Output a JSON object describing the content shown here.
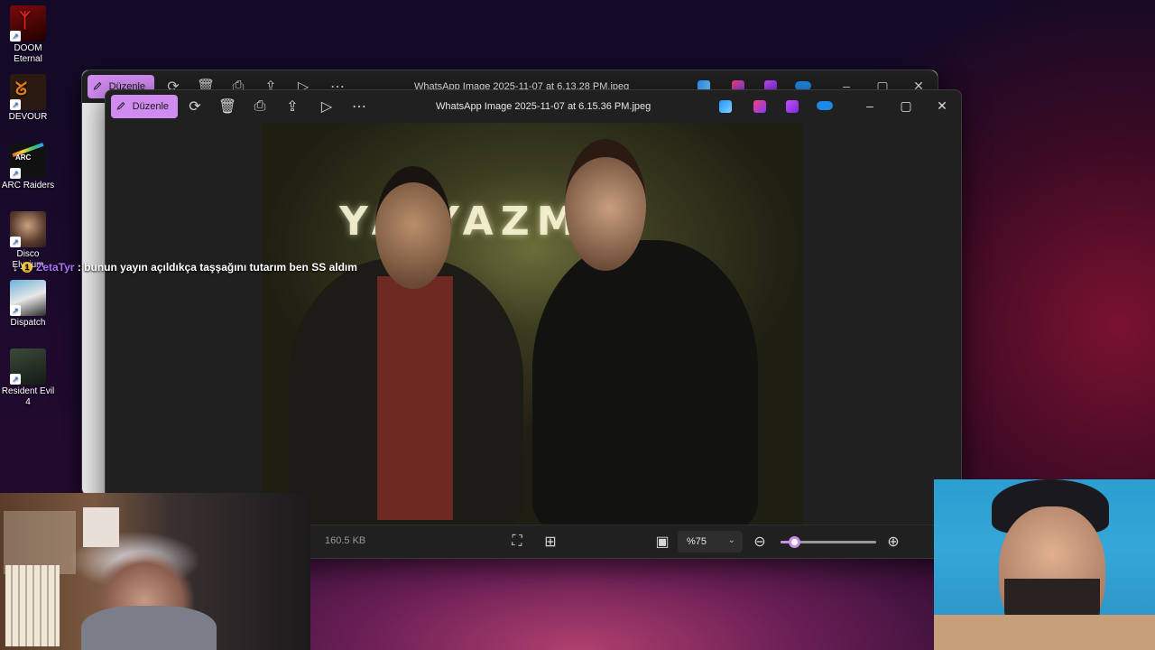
{
  "desktop": {
    "icons": [
      {
        "label": "DOOM Eternal",
        "icon": "doom-eternal-icon"
      },
      {
        "label": "DEVOUR",
        "icon": "devour-icon"
      },
      {
        "label": "ARC Raiders",
        "icon": "arc-raiders-icon"
      },
      {
        "label": "Disco Elysium",
        "icon": "disco-elysium-icon"
      },
      {
        "label": "Dispatch",
        "icon": "dispatch-icon"
      },
      {
        "label": "Resident Evil 4",
        "icon": "resident-evil-4-icon"
      }
    ]
  },
  "chat_overlay": {
    "username": "ZetaTyr",
    "separator": ":",
    "message": "bunun yayın açıldıkça taşşağını tutarım ben SS aldım",
    "badge_color": "#f5c542",
    "username_color": "#a970ff"
  },
  "back_window": {
    "edit_label": "Düzenle",
    "title": "WhatsApp Image 2025-11-07 at 6.13.28 PM.jpeg"
  },
  "front_window": {
    "edit_label": "Düzenle",
    "title": "WhatsApp Image 2025-11-07 at 6.15.36 PM.jpeg",
    "photo_text": "YA YAZMA",
    "status": {
      "file_size": "160.5 KB",
      "zoom": "%75",
      "zoom_level": 0.14
    },
    "accent_color": "#d08bf0"
  }
}
